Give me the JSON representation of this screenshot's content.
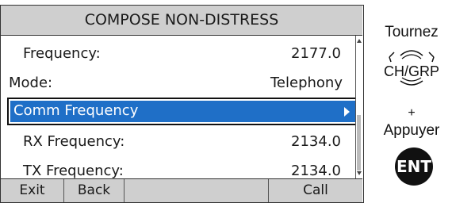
{
  "screen": {
    "title": "COMPOSE NON-DISTRESS",
    "rows": [
      {
        "label": "Frequency:",
        "value": "2177.0"
      },
      {
        "label": "Mode:",
        "value": "Telephony"
      },
      {
        "label": "Comm Frequency",
        "value": ""
      },
      {
        "label": "RX Frequency:",
        "value": "2134.0"
      },
      {
        "label": "TX Frequency:",
        "value": "2134.0"
      }
    ],
    "selected_row": "Comm Frequency",
    "softkeys": [
      "Exit",
      "Back",
      "",
      "Call"
    ]
  },
  "instructions": {
    "turn": "Tournez",
    "dial_label": "CH/GRP",
    "plus": "+",
    "press": "Appuyer",
    "button_label": "ENT"
  },
  "colors": {
    "selection": "#1f6fc7",
    "bars": "#cfcfcf"
  },
  "icons": [
    "chevron-right-icon",
    "scroll-up-icon",
    "scroll-down-icon",
    "dial-knob-icon"
  ]
}
